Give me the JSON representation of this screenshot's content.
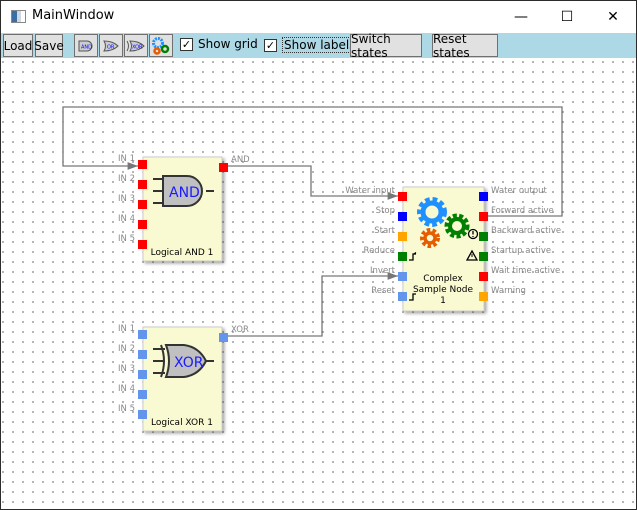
{
  "window": {
    "title": "MainWindow",
    "minimize": "—",
    "maximize": "☐",
    "close": "✕"
  },
  "toolbar": {
    "load": "Load",
    "save": "Save",
    "and_tool": "AND",
    "or_tool": "OR",
    "xor_tool": "XOR",
    "complex_tool": "gears-icon",
    "show_grid": "Show grid",
    "show_grid_checked": true,
    "show_labels": "Show labels",
    "show_labels_checked": true,
    "switch_states": "Switch states",
    "reset_states": "Reset states"
  },
  "colors": {
    "toolbar": "#add8e6",
    "node_fill": "#fafad2",
    "red": "#ff0000",
    "blue": "#0000ff",
    "lightblue": "#6495ed",
    "orange": "#ffa500",
    "green": "#008000"
  },
  "nodes": {
    "and": {
      "title": "Logical AND 1",
      "gate": "AND",
      "inputs": [
        "IN 1",
        "IN 2",
        "IN 3",
        "IN 4",
        "IN 5"
      ],
      "output": "AND"
    },
    "xor": {
      "title": "Logical XOR 1",
      "gate": "XOR",
      "inputs": [
        "IN 1",
        "IN 2",
        "IN 3",
        "IN 4",
        "IN 5"
      ],
      "output": "XOR"
    },
    "complex": {
      "title_1": "Complex",
      "title_2": "Sample Node",
      "title_3": "1",
      "inputs": [
        {
          "label": "Water input",
          "color": "#ff0000"
        },
        {
          "label": "Stop",
          "color": "#0000ff"
        },
        {
          "label": "Start",
          "color": "#ffa500"
        },
        {
          "label": "Reduce",
          "color": "#008000"
        },
        {
          "label": "Invert",
          "color": "#6495ed"
        },
        {
          "label": "Reset",
          "color": "#6495ed"
        }
      ],
      "outputs": [
        {
          "label": "Water output",
          "color": "#0000ff"
        },
        {
          "label": "Forward active",
          "color": "#ff0000"
        },
        {
          "label": "Backward active",
          "color": "#008000"
        },
        {
          "label": "Startup active",
          "color": "#008000"
        },
        {
          "label": "Wait time active",
          "color": "#ff0000"
        },
        {
          "label": "Warning",
          "color": "#ffa500"
        }
      ]
    }
  }
}
